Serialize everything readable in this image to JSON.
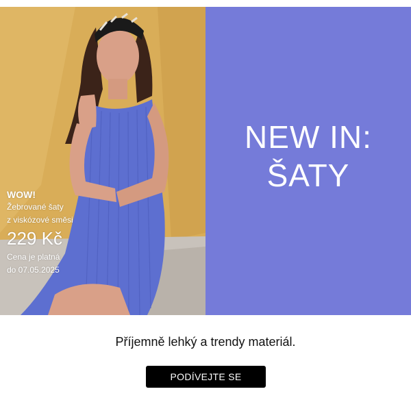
{
  "promo": {
    "badge": "WOW!",
    "line1": "Žebrované šaty",
    "line2": "z viskózové směsi",
    "price": "229 Kč",
    "validity1": "Cena je platná",
    "validity2": "do 07.05.2025"
  },
  "headline": {
    "line1": "NEW IN:",
    "line2": "ŠATY"
  },
  "subtitle": "Příjemně lehký a trendy materiál.",
  "cta": {
    "label": "PODÍVEJTE SE"
  },
  "colors": {
    "panel": "#757bd9",
    "photo_wall": "#d6ab55",
    "dress": "#5d6fd0",
    "cta_bg": "#000000"
  }
}
